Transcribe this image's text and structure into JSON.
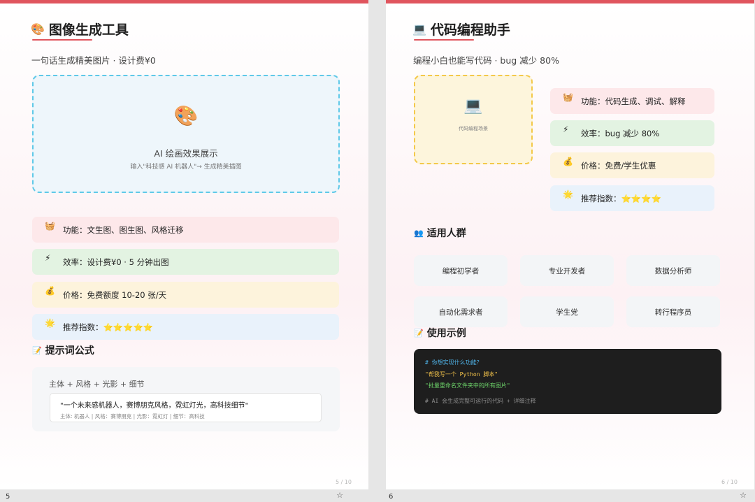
{
  "left": {
    "title_icon": "palette-icon",
    "title_emoji": "🎨",
    "title": "图像生成工具",
    "subtitle": "一句话生成精美图片 · 设计费¥0",
    "showcase": {
      "icon": "palette-icon",
      "emoji": "🎨",
      "title": "AI 绘画效果展示",
      "subtitle": "输入\"科技感 AI 机器人\"→ 生成精美插图"
    },
    "cards": [
      {
        "icon": "basket-icon",
        "emoji": "🧺",
        "text": "功能：文生图、图生图、风格迁移",
        "color": "#fde8ea"
      },
      {
        "icon": "lightning-icon",
        "emoji": "⚡",
        "text": "效率：设计费¥0 · 5 分钟出图",
        "color": "#e3f3e2"
      },
      {
        "icon": "money-bag-icon",
        "emoji": "💰",
        "text": "价格：免费额度 10-20 张/天",
        "color": "#fdf3dc"
      },
      {
        "icon": "sparkle-icon",
        "emoji": "🌟",
        "text": "推荐指数：⭐⭐⭐⭐⭐",
        "color": "#e9f2fb"
      }
    ],
    "prompt_section": {
      "icon": "memo-icon",
      "emoji": "📝",
      "title": "提示词公式",
      "formula": "主体 + 风格 + 光影 + 细节",
      "example": "\"一个未来感机器人，赛博朋克风格，霓虹灯光，高科技细节\"",
      "example_parts": "主体: 机器人 | 风格：赛博朋克 | 光影：霓虹灯 | 细节：高科技"
    },
    "page_num": "5 / 10",
    "bottom_label": "5"
  },
  "right": {
    "title_icon": "laptop-icon",
    "title_emoji": "💻",
    "title": "代码编程助手",
    "subtitle": "编程小白也能写代码 · bug 减少 80%",
    "scene": {
      "icon": "laptop-icon",
      "emoji": "💻",
      "label": "代码编程场景"
    },
    "cards": [
      {
        "icon": "basket-icon",
        "emoji": "🧺",
        "text": "功能：代码生成、调试、解释",
        "color": "#fde8ea"
      },
      {
        "icon": "lightning-icon",
        "emoji": "⚡",
        "text": "效率：bug 减少 80%",
        "color": "#e3f3e2"
      },
      {
        "icon": "money-bag-icon",
        "emoji": "💰",
        "text": "价格：免费/学生优惠",
        "color": "#fdf3dc"
      },
      {
        "icon": "sparkle-icon",
        "emoji": "🌟",
        "text": "推荐指数：⭐⭐⭐⭐",
        "color": "#e9f2fb"
      }
    ],
    "audience": {
      "icon": "people-icon",
      "emoji": "👥",
      "title": "适用人群",
      "items": [
        "编程初学者",
        "专业开发者",
        "数据分析师",
        "自动化需求者",
        "学生党",
        "转行程序员"
      ]
    },
    "usage": {
      "icon": "memo-icon",
      "emoji": "📝",
      "title": "使用示例",
      "code": [
        "# 你想实现什么功能？",
        "\"帮我写一个 Python 脚本\"",
        "\"批量重命名文件夹中的所有图片\"",
        "# AI 会生成完整可运行的代码 + 详细注释"
      ]
    },
    "page_num": "6 / 10",
    "bottom_label": "6"
  }
}
